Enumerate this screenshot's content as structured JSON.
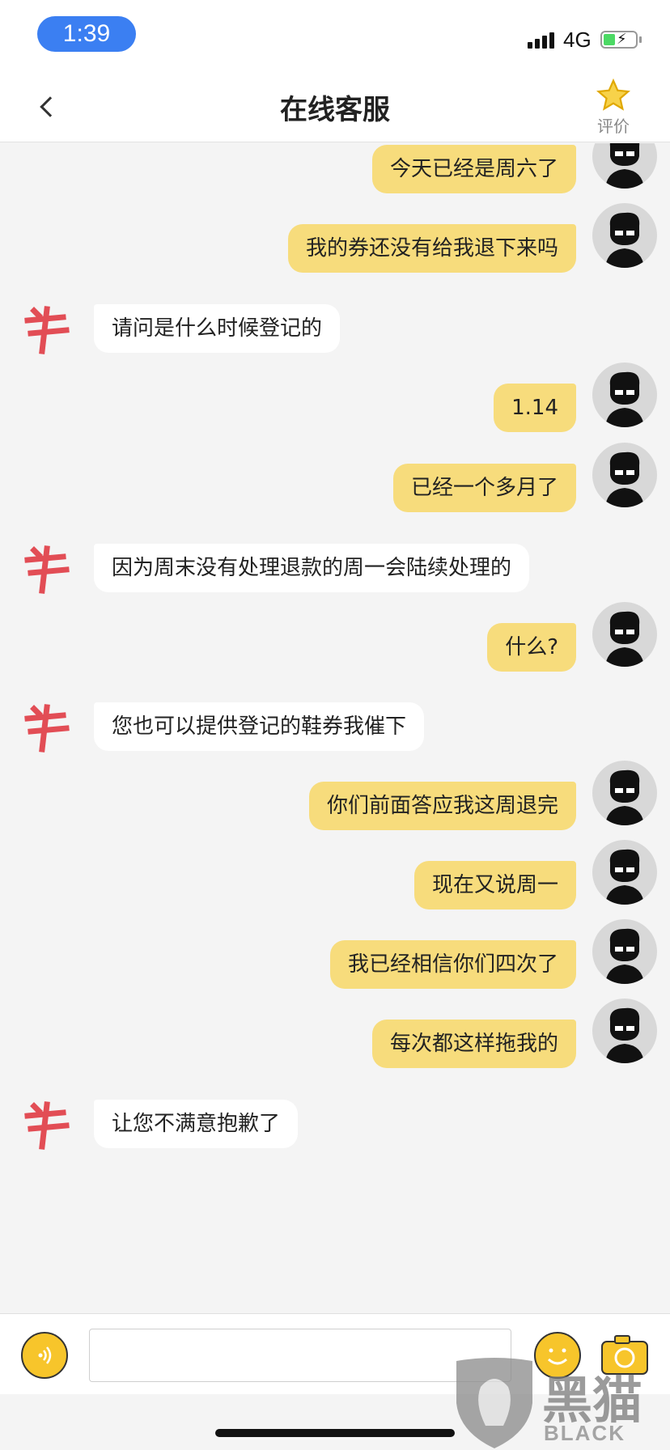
{
  "status_bar": {
    "time": "1:39",
    "network": "4G"
  },
  "nav": {
    "title": "在线客服",
    "rate_label": "评价",
    "back_icon": "chevron-left-icon",
    "rate_icon": "star-icon"
  },
  "messages": [
    {
      "from": "me",
      "text": "今天已经是周六了"
    },
    {
      "from": "me",
      "text": "我的券还没有给我退下来吗"
    },
    {
      "from": "cs",
      "text": "请问是什么时候登记的"
    },
    {
      "from": "me",
      "text": "1.14"
    },
    {
      "from": "me",
      "text": "已经一个多月了"
    },
    {
      "from": "cs",
      "text": "因为周末没有处理退款的周一会陆续处理的"
    },
    {
      "from": "me",
      "text": "什么?"
    },
    {
      "from": "cs",
      "text": "您也可以提供登记的鞋券我催下"
    },
    {
      "from": "me",
      "text": "你们前面答应我这周退完"
    },
    {
      "from": "me",
      "text": "现在又说周一"
    },
    {
      "from": "me",
      "text": "我已经相信你们四次了"
    },
    {
      "from": "me",
      "text": "每次都这样拖我的"
    },
    {
      "from": "cs",
      "text": "让您不满意抱歉了"
    }
  ],
  "input": {
    "value": "",
    "placeholder": ""
  },
  "watermark": {
    "cn": "黑猫",
    "en": "BLACK CAT"
  },
  "colors": {
    "my_bubble": "#f7dc7c",
    "cs_bubble": "#ffffff",
    "accent": "#f7c52b",
    "time_pill": "#3b7ff2"
  }
}
